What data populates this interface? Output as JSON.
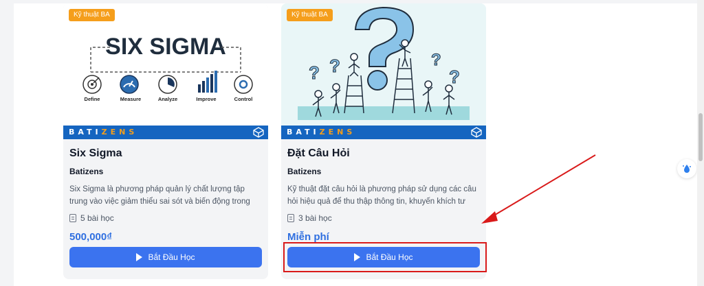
{
  "courses": [
    {
      "tag": "Kỹ thuật BA",
      "brand": "BATIZENS",
      "thumb_title": "SIX SIGMA",
      "phases": [
        "Define",
        "Measure",
        "Analyze",
        "Improve",
        "Control"
      ],
      "title": "Six Sigma",
      "author": "Batizens",
      "description": "Six Sigma là phương pháp quản lý chất lượng tập trung vào việc giảm thiểu sai sót và biến động trong quy trình sản xuấ...",
      "lessons": "5 bài học",
      "price": "500,000₫",
      "button": "Bắt Đầu Học"
    },
    {
      "tag": "Kỹ thuật BA",
      "brand": "BATIZENS",
      "title": "Đặt Câu Hỏi",
      "author": "Batizens",
      "description": "Kỹ thuật đặt câu hỏi là phương pháp sử dụng các câu hỏi hiệu quả để thu thập thông tin, khuyến khích tư duy sáng tạ...",
      "lessons": "3 bài học",
      "price": "Miễn phí",
      "button": "Bắt Đầu Học"
    }
  ],
  "colors": {
    "accent": "#3b73ef",
    "price": "#2f6fe0",
    "tag": "#f59e1b",
    "brand_bar": "#1565c0",
    "annotation": "#d91a1a"
  },
  "icons": {
    "play": "play-icon",
    "lessons": "document-icon",
    "floating": "water-drop-icon"
  }
}
